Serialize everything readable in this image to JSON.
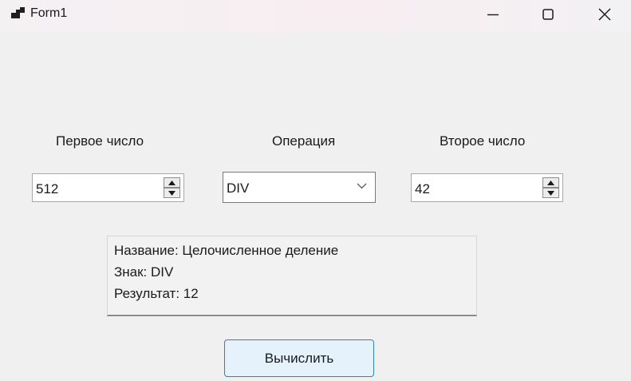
{
  "window": {
    "title": "Form1",
    "icon": "app-window-icon",
    "controls": [
      "minimize-icon",
      "maximize-icon",
      "close-icon"
    ]
  },
  "form": {
    "first_number": {
      "label": "Первое число",
      "value": "512"
    },
    "operation": {
      "label": "Операция",
      "value": "DIV"
    },
    "second_number": {
      "label": "Второе число",
      "value": "42"
    }
  },
  "result": {
    "name_line": "Название: Целочисленное деление",
    "sign_line": "Знак: DIV",
    "result_line": "Результат: 12"
  },
  "calculate_button": {
    "label": "Вычислить"
  },
  "colors": {
    "background": "#f0f0f0",
    "button_bg": "#e5f1fb",
    "button_border": "#2f7fd0"
  }
}
